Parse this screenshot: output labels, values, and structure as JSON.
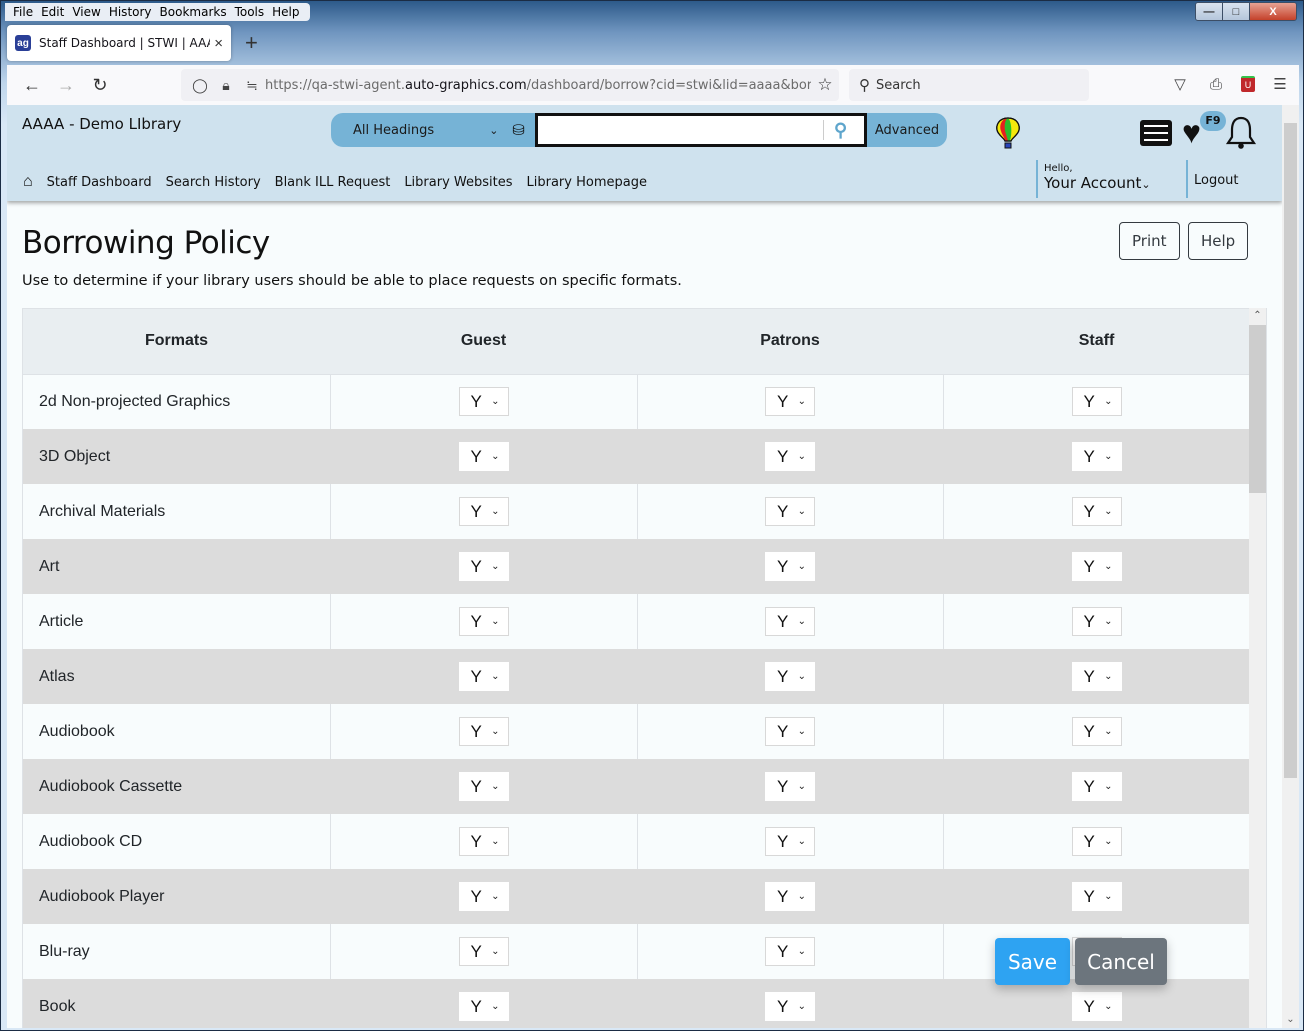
{
  "browser": {
    "menu": [
      "File",
      "Edit",
      "View",
      "History",
      "Bookmarks",
      "Tools",
      "Help"
    ],
    "menu_accel": [
      "F",
      "E",
      "V",
      "s",
      "B",
      "T",
      "H"
    ],
    "tab": {
      "title": "Staff Dashboard | STWI | AAAA |",
      "favicon": "ag",
      "close": "×"
    },
    "new_tab": "+",
    "url": {
      "prefix": "https://qa-stwi-agent.",
      "domain": "auto-graphics.com",
      "path": "/dashboard/borrow?cid=stwi&lid=aaaa&borrow"
    },
    "search_placeholder": "Search",
    "window_controls": {
      "minimize": "—",
      "maximize": "□",
      "close": "X"
    }
  },
  "header": {
    "library_name": "AAAA - Demo LIbrary",
    "search_scope": "All Headings",
    "search_value": "",
    "advanced_label": "Advanced",
    "favorites_badge": "F9",
    "nav": [
      "Staff Dashboard",
      "Search History",
      "Blank ILL Request",
      "Library Websites",
      "Library Homepage"
    ],
    "greeting": "Hello,",
    "account_label": "Your Account",
    "logout_label": "Logout"
  },
  "page": {
    "title": "Borrowing Policy",
    "description": "Use to determine if your library users should be able to place requests on specific formats.",
    "print_label": "Print",
    "help_label": "Help",
    "save_label": "Save",
    "cancel_label": "Cancel"
  },
  "table": {
    "columns": [
      "Formats",
      "Guest",
      "Patrons",
      "Staff"
    ],
    "rows": [
      {
        "format": "2d Non-projected Graphics",
        "guest": "Y",
        "patrons": "Y",
        "staff": "Y"
      },
      {
        "format": "3D Object",
        "guest": "Y",
        "patrons": "Y",
        "staff": "Y"
      },
      {
        "format": "Archival Materials",
        "guest": "Y",
        "patrons": "Y",
        "staff": "Y"
      },
      {
        "format": "Art",
        "guest": "Y",
        "patrons": "Y",
        "staff": "Y"
      },
      {
        "format": "Article",
        "guest": "Y",
        "patrons": "Y",
        "staff": "Y"
      },
      {
        "format": "Atlas",
        "guest": "Y",
        "patrons": "Y",
        "staff": "Y"
      },
      {
        "format": "Audiobook",
        "guest": "Y",
        "patrons": "Y",
        "staff": "Y"
      },
      {
        "format": "Audiobook Cassette",
        "guest": "Y",
        "patrons": "Y",
        "staff": "Y"
      },
      {
        "format": "Audiobook CD",
        "guest": "Y",
        "patrons": "Y",
        "staff": "Y"
      },
      {
        "format": "Audiobook Player",
        "guest": "Y",
        "patrons": "Y",
        "staff": "Y"
      },
      {
        "format": "Blu-ray",
        "guest": "Y",
        "patrons": "Y",
        "staff": "Y"
      },
      {
        "format": "Book",
        "guest": "Y",
        "patrons": "Y",
        "staff": "Y"
      }
    ]
  }
}
